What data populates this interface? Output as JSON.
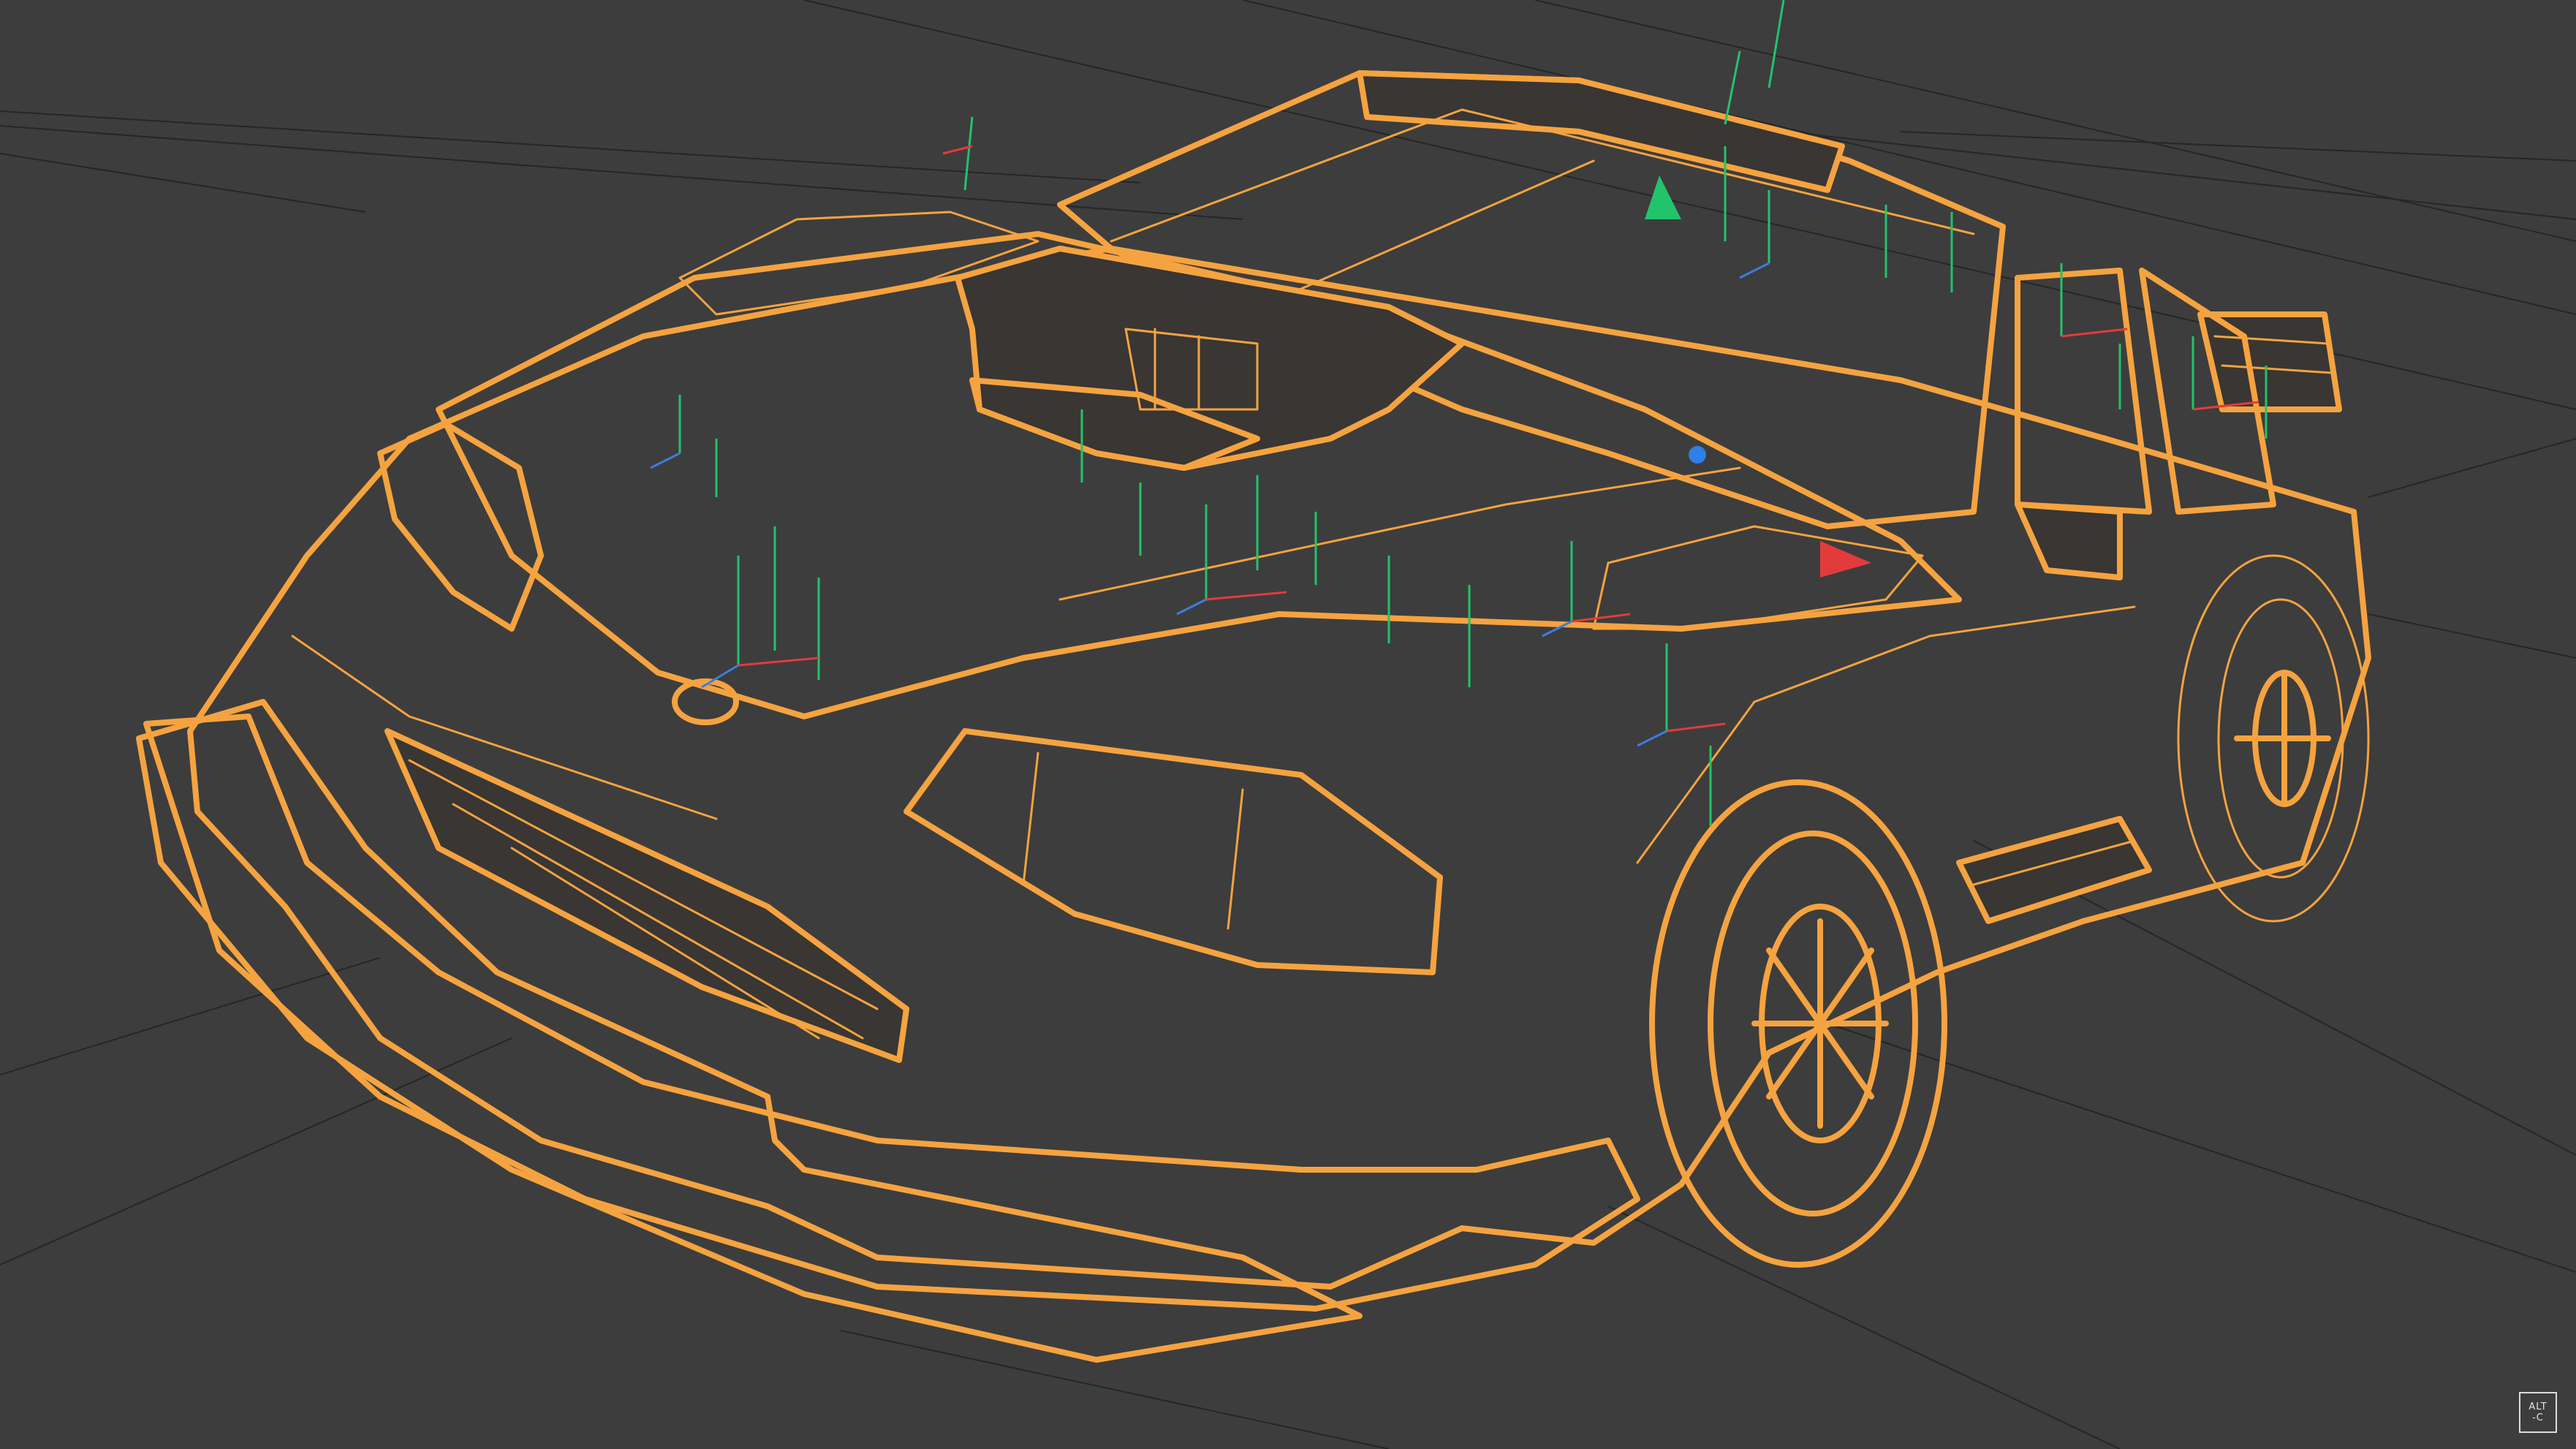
{
  "viewport": {
    "background_color": "#3d3d3d",
    "display_mode": "wireframe",
    "selected_object_color": "#f5a340",
    "ground_grid_color": "#262626"
  },
  "model": {
    "object": "car",
    "selected": true
  },
  "gizmos": {
    "y_axis_color": "#21c46b",
    "x_axis_color": "#e33b3b",
    "z_axis_color": "#3c7de0"
  },
  "badge": {
    "text": "ALT\n-C",
    "color": "#e6e6e6"
  }
}
